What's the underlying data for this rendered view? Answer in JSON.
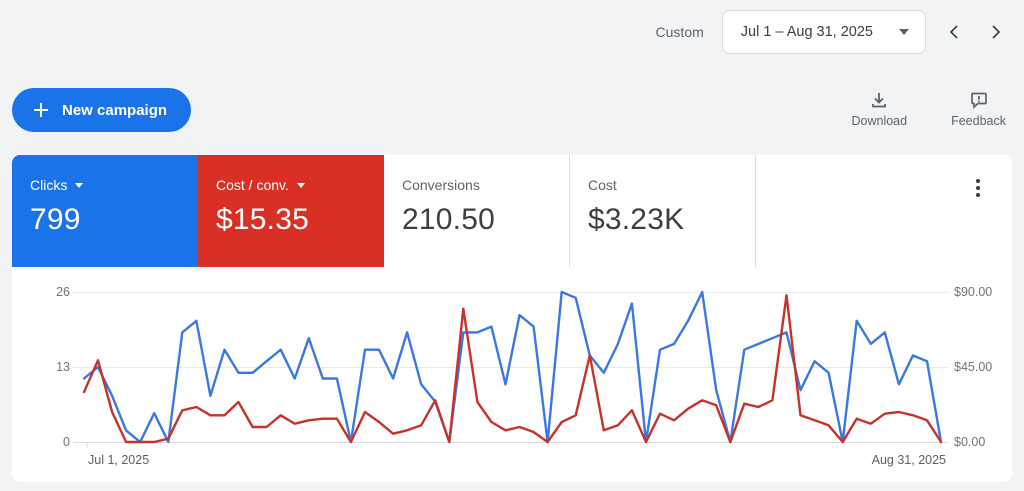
{
  "header": {
    "custom_label": "Custom",
    "date_range": "Jul 1 – Aug 31, 2025"
  },
  "toolbar": {
    "new_campaign_label": "New campaign",
    "download_label": "Download",
    "feedback_label": "Feedback"
  },
  "scorecards": [
    {
      "label": "Clicks",
      "value": "799",
      "selected": true,
      "color": "#1a73e8"
    },
    {
      "label": "Cost / conv.",
      "value": "$15.35",
      "selected": true,
      "color": "#d93025"
    },
    {
      "label": "Conversions",
      "value": "210.50",
      "selected": false,
      "color": "#ffffff"
    },
    {
      "label": "Cost",
      "value": "$3.23K",
      "selected": false,
      "color": "#ffffff"
    }
  ],
  "chart_data": {
    "type": "line",
    "title": "",
    "grid": "horizontal",
    "legend_position": "none",
    "x_ticks": [
      "Jul 1, 2025",
      "Aug 31, 2025"
    ],
    "x_range_days": 62,
    "y_left": {
      "label": "Clicks",
      "ticks": [
        "26",
        "13",
        "0"
      ],
      "max": 26
    },
    "y_right": {
      "label": "Cost / conv.",
      "ticks": [
        "$90.00",
        "$45.00",
        "$0.00"
      ],
      "max": 90
    },
    "series": [
      {
        "name": "Clicks",
        "axis": "left",
        "color": "#3b78e0",
        "values": [
          11,
          13,
          8,
          2,
          0,
          5,
          0,
          19,
          21,
          8,
          16,
          12,
          12,
          14,
          16,
          11,
          18,
          11,
          11,
          0,
          16,
          16,
          11,
          19,
          10,
          7,
          0,
          19,
          19,
          20,
          10,
          22,
          20,
          0,
          26,
          25,
          15,
          12,
          17,
          24,
          0,
          16,
          17,
          21,
          26,
          9,
          0,
          16,
          17,
          18,
          19,
          9,
          14,
          12,
          0,
          21,
          17,
          19,
          10,
          15,
          14,
          0
        ]
      },
      {
        "name": "Cost / conv.",
        "axis": "right",
        "color": "#c5332b",
        "values": [
          30,
          49,
          18,
          0,
          0,
          0,
          2,
          19,
          21,
          16,
          16,
          24,
          9,
          9,
          16,
          11,
          13,
          14,
          14,
          0,
          18,
          12,
          5,
          7,
          10,
          25,
          0,
          80,
          24,
          12,
          7,
          9,
          6,
          0,
          12,
          16,
          52,
          7,
          10,
          19,
          0,
          17,
          13,
          20,
          25,
          22,
          0,
          23,
          21,
          25,
          88,
          16,
          13,
          10,
          0,
          14,
          11,
          17,
          18,
          16,
          13,
          0
        ]
      }
    ]
  }
}
